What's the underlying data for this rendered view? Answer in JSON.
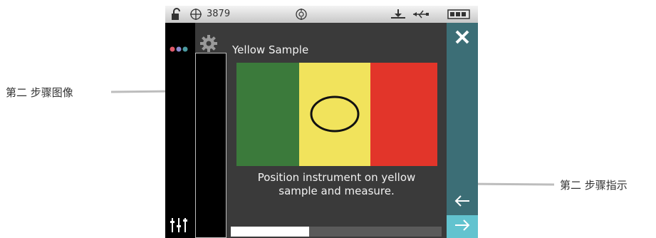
{
  "annotations": {
    "left_label": "第二 步骤图像",
    "right_label": "第二 步骤指示"
  },
  "status_bar": {
    "lock_icon": "unlock-icon",
    "target_icon": "crosshair-icon",
    "count": "3879",
    "center_icon": "target-circle-icon",
    "usb_icons": [
      "usb-download-icon",
      "usb-icon"
    ],
    "battery_icon": "battery-icon"
  },
  "header": {
    "menu_icon": "dots-menu-icon",
    "settings_icon": "gear-icon",
    "title": "Yellow Sample"
  },
  "step": {
    "image_icon": "sample-photo",
    "stripe_colors": [
      "#3a7a3a",
      "#f0e05a",
      "#e23a2a"
    ],
    "instruction_line1": "Position instrument on yellow",
    "instruction_line2": "sample and measure.",
    "progress": 0.37
  },
  "right_rail": {
    "close_icon": "close-icon",
    "back_icon": "arrow-left-icon",
    "next_icon": "arrow-right-icon"
  },
  "left_rail": {
    "tools_icon": "sliders-icon"
  }
}
